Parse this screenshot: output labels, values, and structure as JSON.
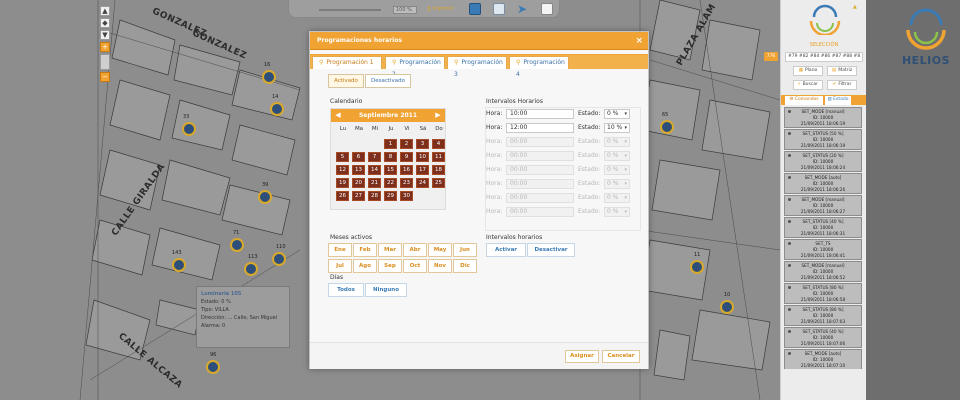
{
  "map": {
    "streets": [
      "GONZALEZ",
      "GONZALEZ",
      "PLAZA ALAM",
      "CALLE GIRALDA",
      "CALLE ALCAZA"
    ],
    "marker_labels": [
      "16",
      "14",
      "33",
      "39",
      "71",
      "143",
      "113",
      "110",
      "96",
      "65",
      "11",
      "10"
    ]
  },
  "info_box": {
    "title": "Luminaria 105",
    "estado": "Estado: 0 %",
    "tipo": "Tipo: VILLA",
    "direccion": "Dirección: ... Calle, San Miguel",
    "alarma": "Alarma: 0"
  },
  "topbar": {
    "zoom_value": "100 %",
    "print_label": "Imprimir"
  },
  "dialog": {
    "title": "Programaciones horarios",
    "close": "×",
    "tabs": [
      {
        "label": "Programación 1"
      },
      {
        "label": "Programación 2"
      },
      {
        "label": "Programación 3"
      },
      {
        "label": "Programación 4"
      }
    ],
    "segments": {
      "on": "Activado",
      "off": "Desactivado"
    },
    "calendar": {
      "label": "Calendario",
      "month": "Septiembre 2011",
      "dow": [
        "Lu",
        "Ma",
        "Mi",
        "Ju",
        "Vi",
        "Sá",
        "Do"
      ],
      "days": [
        "1",
        "2",
        "3",
        "4",
        "5",
        "6",
        "7",
        "8",
        "9",
        "10",
        "11",
        "12",
        "13",
        "14",
        "15",
        "16",
        "17",
        "18",
        "19",
        "20",
        "21",
        "22",
        "23",
        "24",
        "25",
        "26",
        "27",
        "28",
        "29",
        "30"
      ]
    },
    "intervals": {
      "label": "Intervalos Horarios",
      "hora_label": "Hora:",
      "estado_label": "Estado:",
      "rows": [
        {
          "hora": "10:00",
          "estado": "0 %"
        },
        {
          "hora": "12:00",
          "estado": "10 %"
        },
        {
          "hora": "00:00",
          "estado": "0 %"
        },
        {
          "hora": "00:00",
          "estado": "0 %"
        },
        {
          "hora": "00:00",
          "estado": "0 %"
        },
        {
          "hora": "00:00",
          "estado": "0 %"
        },
        {
          "hora": "00:00",
          "estado": "0 %"
        },
        {
          "hora": "00:00",
          "estado": "0 %"
        }
      ]
    },
    "meses": {
      "label": "Meses activos",
      "months": [
        "Ene",
        "Feb",
        "Mar",
        "Abr",
        "May",
        "Jun",
        "Jul",
        "Ago",
        "Sep",
        "Oct",
        "Nov",
        "Dic"
      ]
    },
    "intervalos_horarios": {
      "label": "Intervalos horarios",
      "activar": "Activar",
      "desactivar": "Desactivar"
    },
    "dias": {
      "label": "Días",
      "todos": "Todos",
      "ninguno": "Ninguno"
    },
    "footer": {
      "asignar": "Asignar",
      "cancelar": "Cancelar"
    }
  },
  "right_panel": {
    "seleccion_label": "SELECCIÓN",
    "combo_value": "#79 #82 #84 #86 #87 #88 #8",
    "btn_plano": "Plano",
    "btn_matriz": "Matriz",
    "btn_buscar": "Buscar",
    "btn_filtrar": "Filtrar",
    "tab_comandos": "Comandos",
    "tab_estado": "Estado",
    "tag": "776",
    "items": [
      {
        "cmd": "SET_MODE [manual]",
        "id": "ID: 10000",
        "ts": "21/09/2011 18:06:19"
      },
      {
        "cmd": "SET_STATUS [50 %]",
        "id": "ID: 10000",
        "ts": "21/09/2011 18:06:19"
      },
      {
        "cmd": "SET_STATUS [20 %]",
        "id": "ID: 10000",
        "ts": "21/09/2011 18:06:24"
      },
      {
        "cmd": "SET_MODE [auto]",
        "id": "ID: 10000",
        "ts": "21/09/2011 18:06:26"
      },
      {
        "cmd": "SET_MODE [manual]",
        "id": "ID: 10000",
        "ts": "21/09/2011 18:06:27"
      },
      {
        "cmd": "SET_STATUS [40 %]",
        "id": "ID: 10000",
        "ts": "21/09/2011 18:06:31"
      },
      {
        "cmd": "SET_TS",
        "id": "ID: 10000",
        "ts": "21/09/2011 18:06:41"
      },
      {
        "cmd": "SET_MODE [manual]",
        "id": "ID: 10000",
        "ts": "21/09/2011 18:06:52"
      },
      {
        "cmd": "SET_STATUS [80 %]",
        "id": "ID: 10000",
        "ts": "21/09/2011 18:06:58"
      },
      {
        "cmd": "SET_STATUS [80 %]",
        "id": "ID: 10000",
        "ts": "21/09/2011 18:07:03"
      },
      {
        "cmd": "SET_STATUS [40 %]",
        "id": "ID: 10000",
        "ts": "21/09/2011 18:07:06"
      },
      {
        "cmd": "SET_MODE [auto]",
        "id": "ID: 10000",
        "ts": "21/09/2011 18:07:10"
      }
    ]
  },
  "brand": {
    "name": "HELIOS",
    "color": "#2f4f75",
    "accent": "#f0a232"
  }
}
